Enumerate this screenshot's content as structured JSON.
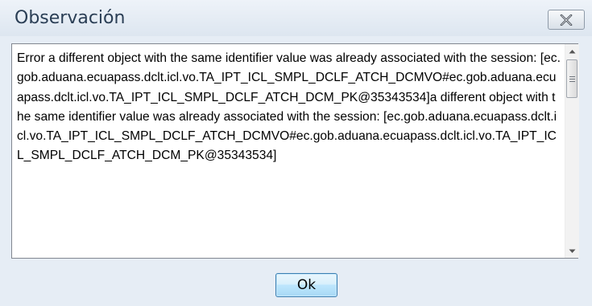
{
  "dialog": {
    "title": "Observación",
    "close_icon": "close-x-icon",
    "message": "Error a different object with the same identifier value was already associated with the session: [ec.gob.aduana.ecuapass.dclt.icl.vo.TA_IPT_ICL_SMPL_DCLF_ATCH_DCMVO#ec.gob.aduana.ecuapass.dclt.icl.vo.TA_IPT_ICL_SMPL_DCLF_ATCH_DCM_PK@35343534]a different object with the same identifier value was already associated with the session: [ec.gob.aduana.ecuapass.dclt.icl.vo.TA_IPT_ICL_SMPL_DCLF_ATCH_DCMVO#ec.gob.aduana.ecuapass.dclt.icl.vo.TA_IPT_ICL_SMPL_DCLF_ATCH_DCM_PK@35343534]",
    "ok_label": "Ok"
  },
  "colors": {
    "window_bg": "#e6edf5",
    "title_text": "#2a3e55",
    "ok_border": "#3c7fb1"
  }
}
